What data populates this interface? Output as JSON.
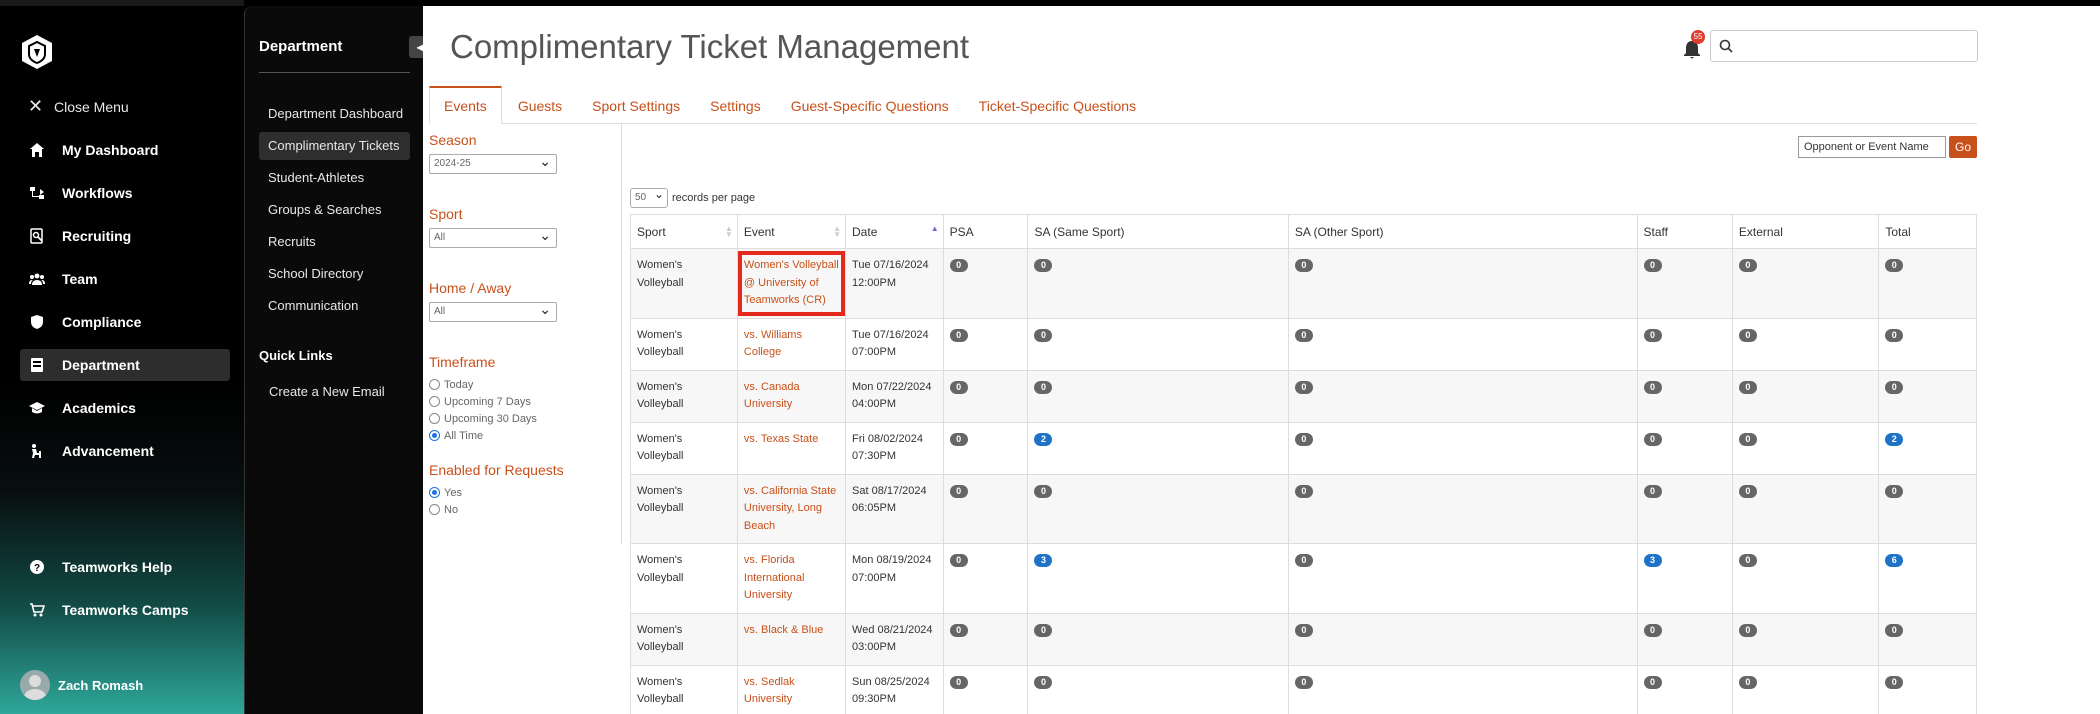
{
  "sidebar": {
    "close_menu": "Close Menu",
    "items": [
      {
        "label": "My Dashboard",
        "icon": "home-icon"
      },
      {
        "label": "Workflows",
        "icon": "workflow-icon"
      },
      {
        "label": "Recruiting",
        "icon": "recruiting-icon"
      },
      {
        "label": "Team",
        "icon": "team-icon"
      },
      {
        "label": "Compliance",
        "icon": "shield-icon"
      },
      {
        "label": "Department",
        "icon": "department-icon",
        "active": true
      },
      {
        "label": "Academics",
        "icon": "graduation-cap-icon"
      },
      {
        "label": "Advancement",
        "icon": "advancement-icon"
      }
    ],
    "bottom_items": [
      {
        "label": "Teamworks Help",
        "icon": "help-icon"
      },
      {
        "label": "Teamworks Camps",
        "icon": "cart-icon"
      }
    ],
    "user_name": "Zach Romash"
  },
  "subpanel": {
    "title": "Department",
    "items": [
      "Department Dashboard",
      "Complimentary Tickets",
      "Student-Athletes",
      "Groups & Searches",
      "Recruits",
      "School Directory",
      "Communication"
    ],
    "active_index": 1,
    "quick_links_title": "Quick Links",
    "quick_link": "Create a New Email"
  },
  "header": {
    "title": "Complimentary Ticket Management",
    "notification_count": "55"
  },
  "tabs": [
    "Events",
    "Guests",
    "Sport Settings",
    "Settings",
    "Guest-Specific Questions",
    "Ticket-Specific Questions"
  ],
  "filters": {
    "season_label": "Season",
    "season_value": "2024-25",
    "sport_label": "Sport",
    "sport_value": "All",
    "home_away_label": "Home / Away",
    "home_away_value": "All",
    "timeframe_label": "Timeframe",
    "timeframe_options": [
      "Today",
      "Upcoming 7 Days",
      "Upcoming 30 Days",
      "All Time"
    ],
    "timeframe_selected": "All Time",
    "enabled_label": "Enabled for Requests",
    "enabled_options": [
      "Yes",
      "No"
    ],
    "enabled_selected": "Yes"
  },
  "search": {
    "event_placeholder": "Opponent or Event Name",
    "go_label": "Go",
    "per_page_value": "50",
    "per_page_label": "records per page"
  },
  "table": {
    "columns": [
      "Sport",
      "Event",
      "Date",
      "PSA",
      "SA (Same Sport)",
      "SA (Other Sport)",
      "Staff",
      "External",
      "Total"
    ],
    "rows": [
      {
        "sport": "Women's Volleyball",
        "event": [
          "Women's Volleyball",
          "@ University of",
          "Teamworks (CR)"
        ],
        "date": [
          "Tue 07/16/2024",
          "12:00PM"
        ],
        "psa": "0",
        "sa_same": "0",
        "sa_other": "0",
        "staff": "0",
        "external": "0",
        "total": "0",
        "highlighted": true
      },
      {
        "sport": "Women's Volleyball",
        "event": [
          "vs. Williams College"
        ],
        "date": [
          "Tue 07/16/2024",
          "07:00PM"
        ],
        "psa": "0",
        "sa_same": "0",
        "sa_other": "0",
        "staff": "0",
        "external": "0",
        "total": "0"
      },
      {
        "sport": "Women's Volleyball",
        "event": [
          "vs. Canada",
          "University"
        ],
        "date": [
          "Mon 07/22/2024",
          "04:00PM"
        ],
        "psa": "0",
        "sa_same": "0",
        "sa_other": "0",
        "staff": "0",
        "external": "0",
        "total": "0"
      },
      {
        "sport": "Women's Volleyball",
        "event": [
          "vs. Texas State"
        ],
        "date": [
          "Fri 08/02/2024",
          "07:30PM"
        ],
        "psa": "0",
        "sa_same": "2",
        "sa_other": "0",
        "staff": "0",
        "external": "0",
        "total": "2"
      },
      {
        "sport": "Women's Volleyball",
        "event": [
          "vs. California State",
          "University, Long",
          "Beach"
        ],
        "date": [
          "Sat 08/17/2024",
          "06:05PM"
        ],
        "psa": "0",
        "sa_same": "0",
        "sa_other": "0",
        "staff": "0",
        "external": "0",
        "total": "0"
      },
      {
        "sport": "Women's Volleyball",
        "event": [
          "vs. Florida",
          "International",
          "University"
        ],
        "date": [
          "Mon 08/19/2024",
          "07:00PM"
        ],
        "psa": "0",
        "sa_same": "3",
        "sa_other": "0",
        "staff": "3",
        "external": "0",
        "total": "6"
      },
      {
        "sport": "Women's Volleyball",
        "event": [
          "vs. Black & Blue"
        ],
        "date": [
          "Wed 08/21/2024",
          "03:00PM"
        ],
        "psa": "0",
        "sa_same": "0",
        "sa_other": "0",
        "staff": "0",
        "external": "0",
        "total": "0"
      },
      {
        "sport": "Women's Volleyball",
        "event": [
          "vs. Sedlak University"
        ],
        "date": [
          "Sun 08/25/2024",
          "09:30PM"
        ],
        "psa": "0",
        "sa_same": "0",
        "sa_other": "0",
        "staff": "0",
        "external": "0",
        "total": "0"
      }
    ]
  },
  "colors": {
    "accent": "#c8501a",
    "highlight": "#e42a1c",
    "badge_blue": "#1f73c7",
    "badge_gray": "#666666"
  }
}
